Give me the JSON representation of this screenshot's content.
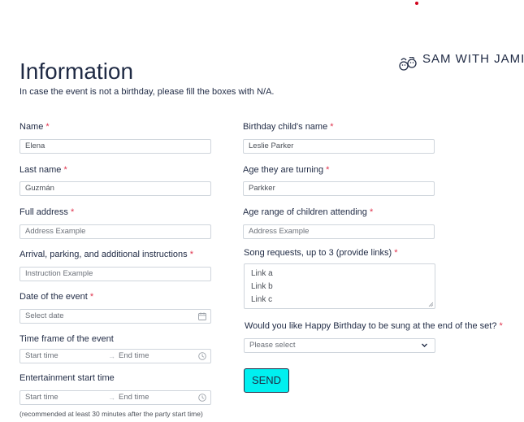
{
  "brand": {
    "icon": "babies-faces-icon",
    "name": "SAM WITH JAMIE"
  },
  "form": {
    "title": "Information",
    "subtitle": "In case the event is not a birthday, please fill the boxes with N/A.",
    "required_mark": "*",
    "left": {
      "name": {
        "label": "Name",
        "value": "Elena"
      },
      "last_name": {
        "label": "Last name",
        "value": "Guzmán"
      },
      "full_address": {
        "label": "Full address",
        "placeholder": "Address Example"
      },
      "instructions": {
        "label": "Arrival, parking, and additional instructions",
        "placeholder": "Instruction Example"
      },
      "date": {
        "label": "Date of the event",
        "placeholder": "Select date"
      },
      "time_frame": {
        "label": "Time frame of the event",
        "start": "Start time",
        "sep": "→",
        "end": "End time"
      },
      "ent_start": {
        "label": "Entertainment start time",
        "start": "Start time",
        "sep": "→",
        "end": "End time"
      },
      "note": "(recommended at least 30 minutes after the party start time)"
    },
    "right": {
      "child_name": {
        "label": "Birthday child's name",
        "value": "Leslie Parker"
      },
      "age_turning": {
        "label": "Age they are turning",
        "value": "Parkker"
      },
      "age_range": {
        "label": "Age range of children attending",
        "placeholder": "Address Example"
      },
      "songs": {
        "label": "Song requests, up to 3 (provide links)",
        "lines": [
          "Link a",
          "Link b",
          "Link c"
        ]
      },
      "happy_birthday": {
        "label": "Would you like Happy Birthday to be sung at the end of the set?",
        "placeholder": "Please select"
      }
    },
    "send_label": "SEND"
  }
}
